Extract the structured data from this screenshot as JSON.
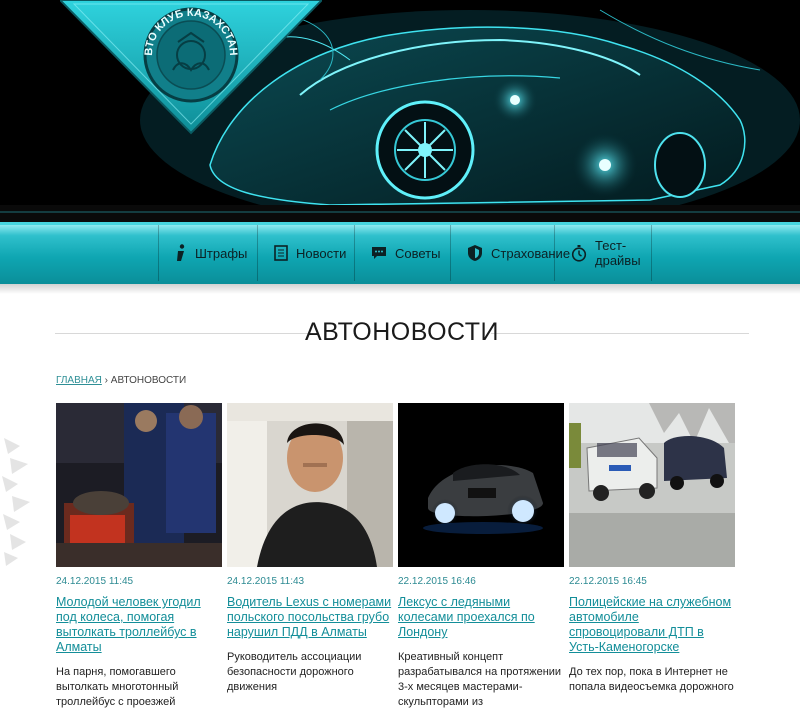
{
  "logo": {
    "text": "АВТО КЛУБ КАЗАХСТАНА"
  },
  "nav": [
    {
      "label": "Штрафы",
      "icon": "info-icon"
    },
    {
      "label": "Новости",
      "icon": "document-icon"
    },
    {
      "label": "Советы",
      "icon": "chat-bubble-icon"
    },
    {
      "label": "Страхование",
      "icon": "shield-icon"
    },
    {
      "label": "Тест-драйвы",
      "icon": "stopwatch-icon"
    }
  ],
  "page_title": "АВТОНОВОСТИ",
  "breadcrumb": {
    "home": "ГЛАВНАЯ",
    "separator": "›",
    "current": "АВТОНОВОСТИ"
  },
  "articles": [
    {
      "date": "24.12.2015 11:45",
      "title": "Молодой человек угодил под колеса, помогая вытолкать троллейбус в Алматы",
      "excerpt": "На парня, помогавшего вытолкать многотонный троллейбус с проезжей"
    },
    {
      "date": "24.12.2015 11:43",
      "title": "Водитель Lexus с номерами польского посольства грубо нарушил ПДД в Алматы",
      "excerpt": "Руководитель ассоциации безопасности дорожного движения"
    },
    {
      "date": "22.12.2015 16:46",
      "title": "Лексус с ледяными колесами проехался по Лондону",
      "excerpt": "Креативный концепт разрабатывался на протяжении 3-х месяцев мастерами-скульпторами из"
    },
    {
      "date": "22.12.2015 16:45",
      "title": "Полицейские на служебном автомобиле спровоцировали ДТП в Усть-Каменогорске",
      "excerpt": "До тех пор, пока в Интернет не попала видеосъемка дорожного"
    }
  ],
  "colors": {
    "accent": "#138e99",
    "nav": "#0fa6b2",
    "hero_bg": "#000000"
  }
}
